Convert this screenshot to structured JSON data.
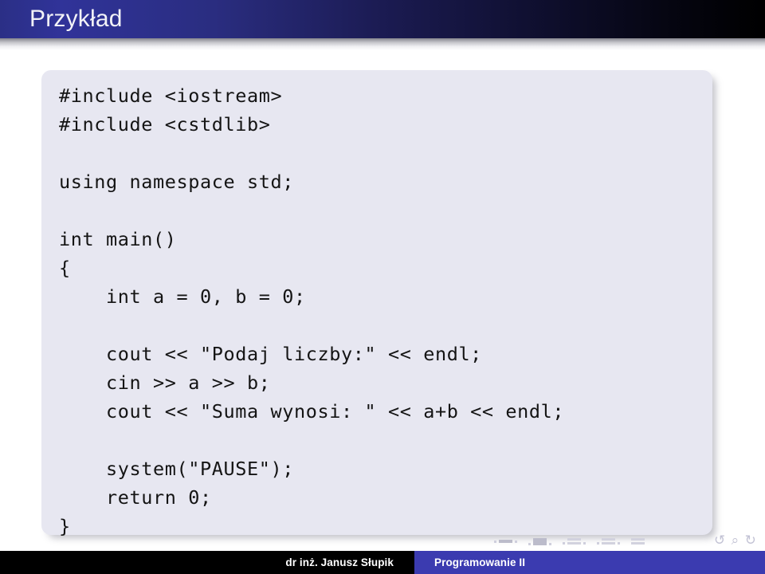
{
  "slide": {
    "title": "Przykład",
    "theme": {
      "title_bar_gradient_start": "#303399",
      "title_bar_gradient_end": "#000000",
      "panel_background": "#e7e7f1",
      "footer_left_background": "#000000",
      "footer_right_background": "#3b3bb0",
      "code_text_color": "#141414",
      "nav_glyph_color": "#c2c2d4"
    }
  },
  "code": {
    "language": "cpp",
    "lines": [
      "#include <iostream>",
      "#include <cstdlib>",
      "",
      "using namespace std;",
      "",
      "int main()",
      "{",
      "    int a = 0, b = 0;",
      "",
      "    cout << \"Podaj liczby:\" << endl;",
      "    cin >> a >> b;",
      "    cout << \"Suma wynosi: \" << a+b << endl;",
      "",
      "    system(\"PAUSE\");",
      "    return 0;",
      "}"
    ]
  },
  "navigation": {
    "back_icon": "undo-arrow-icon",
    "search_icon": "magnifier-icon",
    "forward_icon": "redo-arrow-icon",
    "glyphs": "↶ ↷",
    "arrows_text": "↶ ⌕ ↷"
  },
  "footer": {
    "author": "dr inż. Janusz Słupik",
    "course": "Programowanie II"
  }
}
